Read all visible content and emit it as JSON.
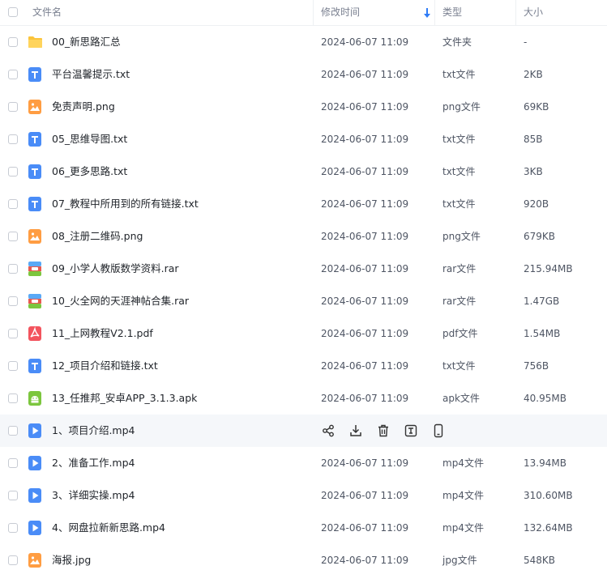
{
  "header": {
    "name": "文件名",
    "modified": "修改时间",
    "type": "类型",
    "size": "大小"
  },
  "rows": [
    {
      "name": "00_新思路汇总",
      "time": "2024-06-07 11:09",
      "type": "文件夹",
      "size": "-",
      "icon": "folder-icon"
    },
    {
      "name": "平台温馨提示.txt",
      "time": "2024-06-07 11:09",
      "type": "txt文件",
      "size": "2KB",
      "icon": "txt-file-icon"
    },
    {
      "name": "免责声明.png",
      "time": "2024-06-07 11:09",
      "type": "png文件",
      "size": "69KB",
      "icon": "image-file-icon"
    },
    {
      "name": "05_思维导图.txt",
      "time": "2024-06-07 11:09",
      "type": "txt文件",
      "size": "85B",
      "icon": "txt-file-icon"
    },
    {
      "name": "06_更多思路.txt",
      "time": "2024-06-07 11:09",
      "type": "txt文件",
      "size": "3KB",
      "icon": "txt-file-icon"
    },
    {
      "name": "07_教程中所用到的所有链接.txt",
      "time": "2024-06-07 11:09",
      "type": "txt文件",
      "size": "920B",
      "icon": "txt-file-icon"
    },
    {
      "name": "08_注册二维码.png",
      "time": "2024-06-07 11:09",
      "type": "png文件",
      "size": "679KB",
      "icon": "image-file-icon"
    },
    {
      "name": "09_小学人教版数学资料.rar",
      "time": "2024-06-07 11:09",
      "type": "rar文件",
      "size": "215.94MB",
      "icon": "rar-file-icon"
    },
    {
      "name": "10_火全网的天涯神帖合集.rar",
      "time": "2024-06-07 11:09",
      "type": "rar文件",
      "size": "1.47GB",
      "icon": "rar-file-icon"
    },
    {
      "name": "11_上网教程V2.1.pdf",
      "time": "2024-06-07 11:09",
      "type": "pdf文件",
      "size": "1.54MB",
      "icon": "pdf-file-icon"
    },
    {
      "name": "12_项目介绍和链接.txt",
      "time": "2024-06-07 11:09",
      "type": "txt文件",
      "size": "756B",
      "icon": "txt-file-icon"
    },
    {
      "name": "13_任推邦_安卓APP_3.1.3.apk",
      "time": "2024-06-07 11:09",
      "type": "apk文件",
      "size": "40.95MB",
      "icon": "apk-file-icon"
    },
    {
      "name": "1、项目介绍.mp4",
      "time": "",
      "type": "",
      "size": "",
      "icon": "video-file-icon",
      "hover": true
    },
    {
      "name": "2、准备工作.mp4",
      "time": "2024-06-07 11:09",
      "type": "mp4文件",
      "size": "13.94MB",
      "icon": "video-file-icon"
    },
    {
      "name": "3、详细实操.mp4",
      "time": "2024-06-07 11:09",
      "type": "mp4文件",
      "size": "310.60MB",
      "icon": "video-file-icon"
    },
    {
      "name": "4、网盘拉新新思路.mp4",
      "time": "2024-06-07 11:09",
      "type": "mp4文件",
      "size": "132.64MB",
      "icon": "video-file-icon"
    },
    {
      "name": "海报.jpg",
      "time": "2024-06-07 11:09",
      "type": "jpg文件",
      "size": "548KB",
      "icon": "image-file-icon"
    }
  ],
  "row_actions": [
    "share-icon",
    "download-icon",
    "delete-icon",
    "rename-icon",
    "phone-icon"
  ],
  "colors": {
    "folder": "#fbc43b",
    "txt": "#4a8cf7",
    "image": "#ff9d42",
    "rar": "#e8594f",
    "pdf": "#f3545e",
    "apk": "#7cc63e",
    "video": "#4a8cf7",
    "sort": "#2f7cf6"
  }
}
